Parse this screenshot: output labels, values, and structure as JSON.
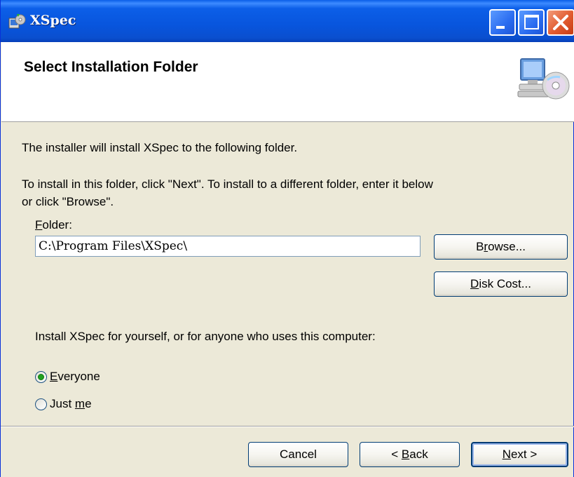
{
  "window": {
    "title": "XSpec",
    "header_title": "Select Installation Folder"
  },
  "body": {
    "intro": "The installer will install XSpec to the following folder.",
    "instructions_line1": "To install in this folder, click \"Next\". To install to a different folder, enter it below",
    "instructions_line2": "or click \"Browse\".",
    "folder_label_mnemonic": "F",
    "folder_label_rest": "older:",
    "folder_value": "C:\\Program Files\\XSpec\\",
    "browse_pre": "B",
    "browse_mnemonic": "r",
    "browse_post": "owse...",
    "disk_cost_mnemonic": "D",
    "disk_cost_post": "isk Cost...",
    "install_for_prompt": "Install XSpec for yourself, or for anyone who uses this computer:",
    "radio_everyone_mnemonic": "E",
    "radio_everyone_rest": "veryone",
    "radio_justme_pre": "Just ",
    "radio_justme_mnemonic": "m",
    "radio_justme_rest": "e",
    "selected_option": "Everyone"
  },
  "footer": {
    "cancel": "Cancel",
    "back_pre": "< ",
    "back_mnemonic": "B",
    "back_post": "ack",
    "next_mnemonic": "N",
    "next_post": "ext >"
  },
  "colors": {
    "titlebar": "#0855DD",
    "dialog_bg": "#ECE9D8",
    "close_button": "#E15A2E"
  },
  "icons": [
    "installer-app-icon",
    "minimize-icon",
    "maximize-icon",
    "close-icon",
    "computer-cd-icon"
  ]
}
